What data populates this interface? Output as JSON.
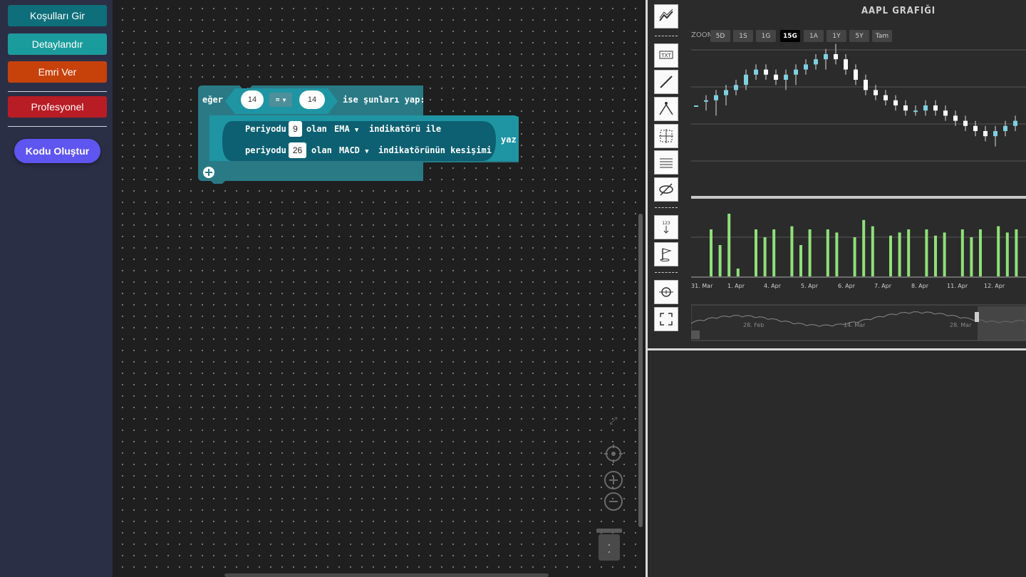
{
  "sidebar": {
    "buttons": [
      {
        "label": "Koşulları Gir",
        "color": "#0e6f7a"
      },
      {
        "label": "Detaylandır",
        "color": "#1b9c9c"
      },
      {
        "label": "Emri Ver",
        "color": "#c7420b"
      },
      {
        "label": "Profesyonel",
        "color": "#b81c24"
      }
    ],
    "generate_label": "Kodu Oluştur"
  },
  "blocks": {
    "if_label": "eğer",
    "left_value": "14",
    "operator": "=",
    "right_value": "14",
    "then_label": "ise şunları yap:",
    "print_label": "yaz",
    "line1": {
      "prefix": "Periyodu",
      "period": "9",
      "mid": "olan",
      "indicator": "EMA",
      "suffix": "indikatörü ile"
    },
    "line2": {
      "prefix": "periyodu",
      "period": "26",
      "mid": "olan",
      "indicator": "MACD",
      "suffix": "indikatörünün kesişimi"
    }
  },
  "chart": {
    "title": "AAPL GRAFIĞI",
    "zoom_label": "ZOOM",
    "zoom_options": [
      "5D",
      "1S",
      "1G",
      "15G",
      "1A",
      "1Y",
      "5Y",
      "Tam"
    ],
    "zoom_active": "15G",
    "x_ticks": [
      "31. Mar",
      "1. Apr",
      "4. Apr",
      "5. Apr",
      "6. Apr",
      "7. Apr",
      "8. Apr",
      "11. Apr",
      "12. Apr"
    ],
    "navigator_ticks": [
      "28. Feb",
      "14. Mar",
      "28. Mar"
    ],
    "tools": [
      "trend-icon",
      "text-icon",
      "line-icon",
      "fib-icon",
      "crosshair-icon",
      "grid-lines-icon",
      "hide-icon",
      "label-123-icon",
      "flag-icon",
      "zoom-icon",
      "fullscreen-icon"
    ],
    "colors": {
      "up": "#7fd0e0",
      "down": "#ffffff",
      "volume": "#8fe07a"
    }
  },
  "chart_data": {
    "type": "candlestick",
    "title": "AAPL GRAFIĞI",
    "x_ticks": [
      "31. Mar",
      "1. Apr",
      "4. Apr",
      "5. Apr",
      "6. Apr",
      "7. Apr",
      "8. Apr",
      "11. Apr",
      "12. Apr"
    ],
    "series": [
      {
        "ohlc": [
          [
            10,
            10,
            10,
            10
          ],
          [
            11,
            12,
            9,
            11
          ],
          [
            11,
            13,
            8,
            12
          ],
          [
            12,
            14,
            10,
            13
          ],
          [
            13,
            15,
            12,
            14
          ],
          [
            14,
            17,
            13,
            16
          ],
          [
            16,
            18,
            15,
            17
          ],
          [
            17,
            18,
            15,
            16
          ],
          [
            16,
            17,
            14,
            15
          ],
          [
            15,
            17,
            13,
            16
          ],
          [
            16,
            18,
            14,
            17
          ],
          [
            17,
            19,
            16,
            18
          ],
          [
            18,
            20,
            17,
            19
          ],
          [
            19,
            21,
            17,
            20
          ],
          [
            20,
            22,
            18,
            19
          ],
          [
            19,
            20,
            16,
            17
          ],
          [
            17,
            18,
            14,
            15
          ],
          [
            15,
            16,
            12,
            13
          ],
          [
            13,
            14,
            11,
            12
          ],
          [
            12,
            13,
            10,
            11
          ],
          [
            11,
            12,
            9,
            10
          ],
          [
            10,
            11,
            8,
            9
          ],
          [
            9,
            10,
            8,
            9
          ],
          [
            9,
            11,
            8,
            10
          ],
          [
            10,
            11,
            8,
            9
          ],
          [
            9,
            10,
            7,
            8
          ],
          [
            8,
            9,
            6,
            7
          ],
          [
            7,
            8,
            5,
            6
          ],
          [
            6,
            7,
            4,
            5
          ],
          [
            5,
            6,
            3,
            4
          ],
          [
            4,
            6,
            2,
            5
          ],
          [
            5,
            7,
            4,
            6
          ],
          [
            6,
            8,
            5,
            7
          ]
        ]
      },
      {
        "volume": [
          3,
          2,
          4,
          0.5,
          0,
          3,
          2.5,
          3,
          0,
          3.2,
          2,
          3,
          0,
          3,
          2.8,
          0,
          2.5,
          3.6,
          3.2,
          0,
          2.6,
          2.8,
          3,
          0,
          3,
          2.6,
          2.8,
          0,
          3,
          2.5,
          3,
          0,
          3.2,
          2.8,
          3
        ]
      }
    ]
  }
}
